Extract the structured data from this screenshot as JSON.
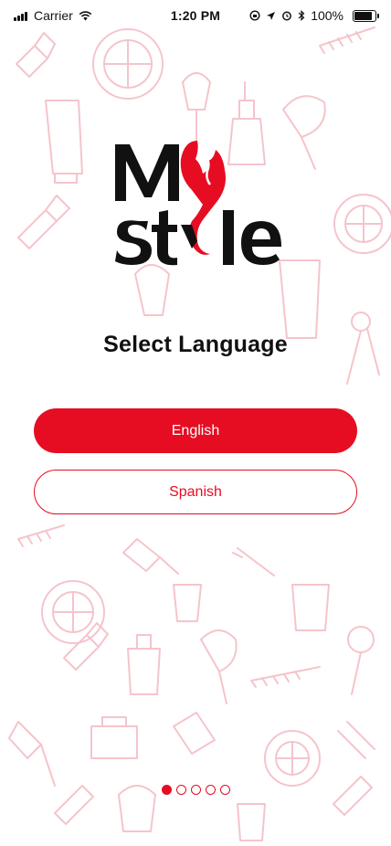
{
  "status_bar": {
    "carrier": "Carrier",
    "time": "1:20 PM",
    "battery": "100%"
  },
  "logo": {
    "text": "My Style"
  },
  "title": "Select Language",
  "buttons": {
    "english": "English",
    "spanish": "Spanish"
  },
  "pagination": {
    "total": 5,
    "active": 1
  },
  "colors": {
    "accent": "#e60d22",
    "pattern": "#f7c9cf"
  }
}
